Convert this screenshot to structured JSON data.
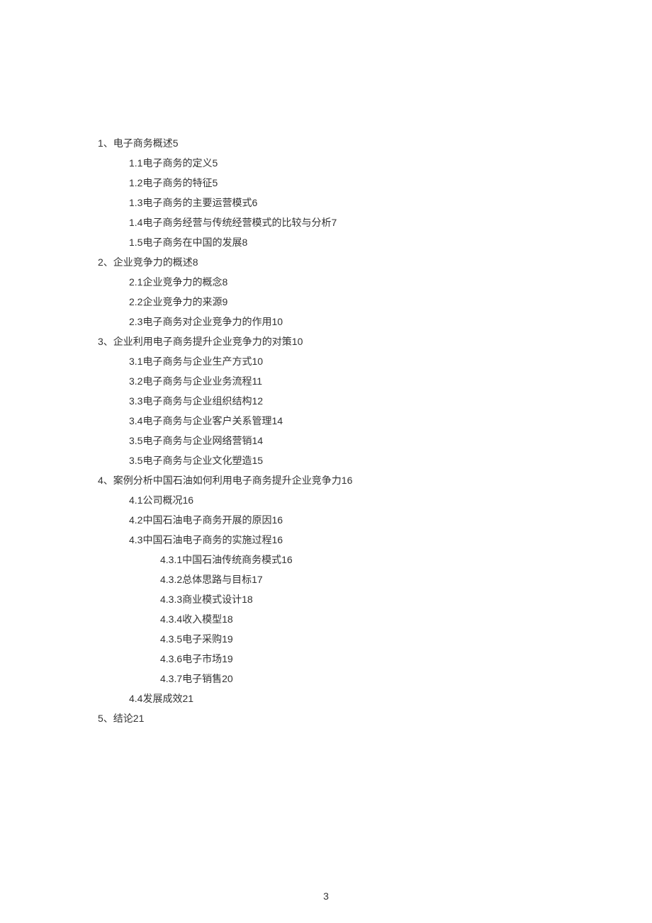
{
  "toc": [
    {
      "level": 0,
      "text": "1、电子商务概述5"
    },
    {
      "level": 1,
      "text": "1.1电子商务的定义5"
    },
    {
      "level": 1,
      "text": "1.2电子商务的特征5"
    },
    {
      "level": 1,
      "text": "1.3电子商务的主要运营模式6"
    },
    {
      "level": 1,
      "text": "1.4电子商务经营与传统经营模式的比较与分析7"
    },
    {
      "level": 1,
      "text": "1.5电子商务在中国的发展8"
    },
    {
      "level": 0,
      "text": "2、企业竞争力的概述8"
    },
    {
      "level": 1,
      "text": "2.1企业竞争力的概念8"
    },
    {
      "level": 1,
      "text": "2.2企业竞争力的来源9"
    },
    {
      "level": 1,
      "text": "2.3电子商务对企业竞争力的作用10"
    },
    {
      "level": 0,
      "text": "3、企业利用电子商务提升企业竞争力的对策10"
    },
    {
      "level": 1,
      "text": "3.1电子商务与企业生产方式10"
    },
    {
      "level": 1,
      "text": "3.2电子商务与企业业务流程11"
    },
    {
      "level": 1,
      "text": "3.3电子商务与企业组织结构12"
    },
    {
      "level": 1,
      "text": "3.4电子商务与企业客户关系管理14"
    },
    {
      "level": 1,
      "text": "3.5电子商务与企业网络营销14"
    },
    {
      "level": 1,
      "text": "3.5电子商务与企业文化塑造15"
    },
    {
      "level": 0,
      "text": "4、案例分析中国石油如何利用电子商务提升企业竞争力16"
    },
    {
      "level": 1,
      "text": "4.1公司概况16"
    },
    {
      "level": 1,
      "text": "4.2中国石油电子商务开展的原因16"
    },
    {
      "level": 1,
      "text": "4.3中国石油电子商务的实施过程16"
    },
    {
      "level": 2,
      "text": "4.3.1中国石油传统商务模式16"
    },
    {
      "level": 2,
      "text": "4.3.2总体思路与目标17"
    },
    {
      "level": 2,
      "text": "4.3.3商业模式设计18"
    },
    {
      "level": 2,
      "text": "4.3.4收入模型18"
    },
    {
      "level": 2,
      "text": "4.3.5电子采购19"
    },
    {
      "level": 2,
      "text": "4.3.6电子市场19"
    },
    {
      "level": 2,
      "text": "4.3.7电子销售20"
    },
    {
      "level": 1,
      "text": "4.4发展成效21"
    },
    {
      "level": 0,
      "text": "5、结论21"
    }
  ],
  "page_number": "3"
}
